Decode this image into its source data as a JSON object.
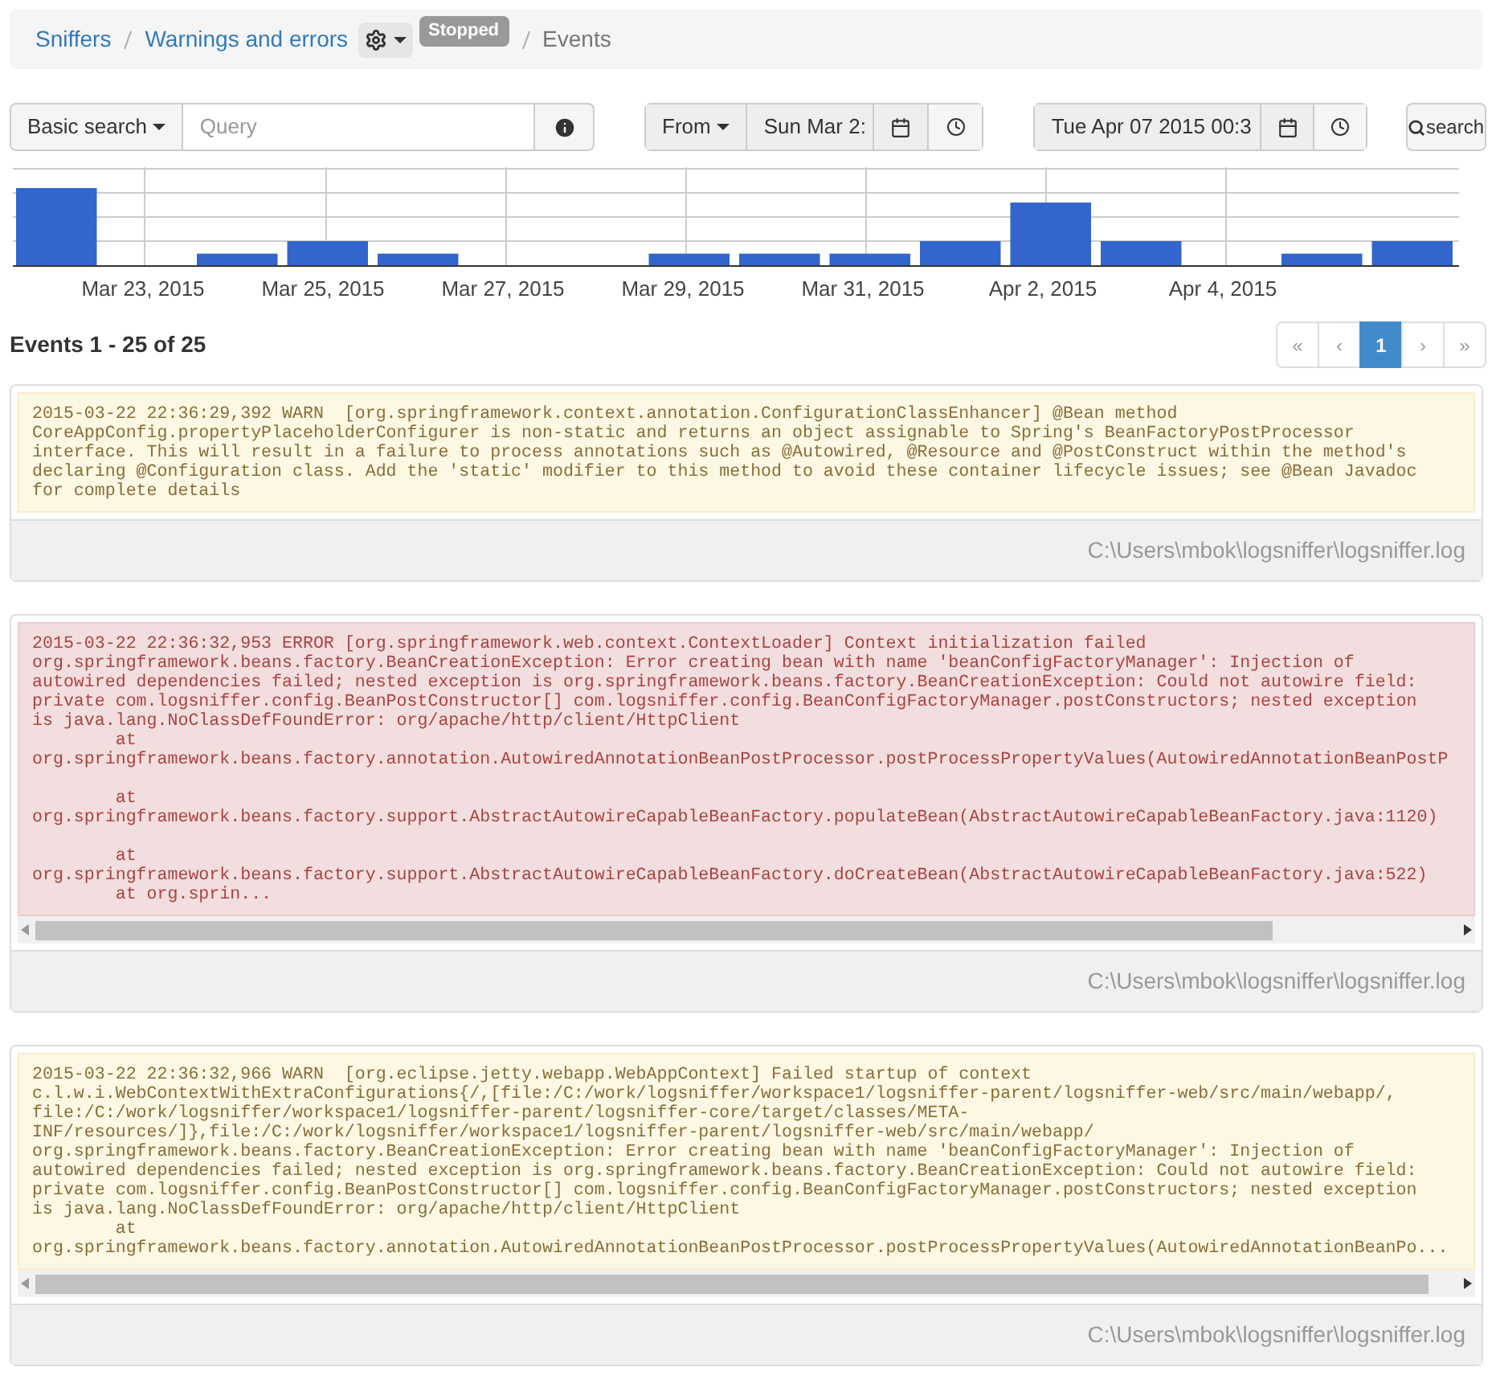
{
  "breadcrumb": {
    "items": [
      {
        "label": "Sniffers",
        "kind": "link"
      },
      {
        "label": "Warnings and errors",
        "kind": "link"
      },
      {
        "label": "Events",
        "kind": "current"
      }
    ],
    "status_badge": "Stopped"
  },
  "search": {
    "mode": "Basic search",
    "placeholder": "Query",
    "from_label": "From",
    "from_value": "Sun Mar 2:",
    "to_value": "Tue Apr 07 2015 00:3",
    "search_button": "search"
  },
  "histogram": {
    "date_labels": [
      "Mar 23, 2015",
      "Mar 25, 2015",
      "Mar 27, 2015",
      "Mar 29, 2015",
      "Mar 31, 2015",
      "Apr 2, 2015",
      "Apr 4, 2015"
    ]
  },
  "events_heading": "Events 1 - 25 of 25",
  "pagination": [
    {
      "label": "«",
      "selected": false
    },
    {
      "label": "‹",
      "selected": false
    },
    {
      "label": "1",
      "selected": true
    },
    {
      "label": "›",
      "selected": false
    },
    {
      "label": "»",
      "selected": false
    }
  ],
  "events": [
    {
      "kind": "warn",
      "scrollable": false,
      "message": "2015-03-22 22:36:29,392 WARN  [org.springframework.context.annotation.ConfigurationClassEnhancer] @Bean method\nCoreAppConfig.propertyPlaceholderConfigurer is non-static and returns an object assignable to Spring's BeanFactoryPostProcessor\ninterface. This will result in a failure to process annotations such as @Autowired, @Resource and @PostConstruct within the method's\ndeclaring @Configuration class. Add the 'static' modifier to this method to avoid these container lifecycle issues; see @Bean Javadoc\nfor complete details",
      "source": "C:\\Users\\mbok\\logsniffer\\logsniffer.log"
    },
    {
      "kind": "error",
      "scrollable": true,
      "message": "2015-03-22 22:36:32,953 ERROR [org.springframework.web.context.ContextLoader] Context initialization failed\norg.springframework.beans.factory.BeanCreationException: Error creating bean with name 'beanConfigFactoryManager': Injection of\nautowired dependencies failed; nested exception is org.springframework.beans.factory.BeanCreationException: Could not autowire field:\nprivate com.logsniffer.config.BeanPostConstructor[] com.logsniffer.config.BeanConfigFactoryManager.postConstructors; nested exception\nis java.lang.NoClassDefFoundError: org/apache/http/client/HttpClient\n        at\norg.springframework.beans.factory.annotation.AutowiredAnnotationBeanPostProcessor.postProcessPropertyValues(AutowiredAnnotationBeanPostP\n\n        at\norg.springframework.beans.factory.support.AbstractAutowireCapableBeanFactory.populateBean(AbstractAutowireCapableBeanFactory.java:1120)\n\n        at\norg.springframework.beans.factory.support.AbstractAutowireCapableBeanFactory.doCreateBean(AbstractAutowireCapableBeanFactory.java:522)\n        at org.sprin...",
      "source": "C:\\Users\\mbok\\logsniffer\\logsniffer.log"
    },
    {
      "kind": "warn",
      "scrollable": true,
      "message": "2015-03-22 22:36:32,966 WARN  [org.eclipse.jetty.webapp.WebAppContext] Failed startup of context\nc.l.w.i.WebContextWithExtraConfigurations{/,[file:/C:/work/logsniffer/workspace1/logsniffer-parent/logsniffer-web/src/main/webapp/,\nfile:/C:/work/logsniffer/workspace1/logsniffer-parent/logsniffer-core/target/classes/META-\nINF/resources/]},file:/C:/work/logsniffer/workspace1/logsniffer-parent/logsniffer-web/src/main/webapp/\norg.springframework.beans.factory.BeanCreationException: Error creating bean with name 'beanConfigFactoryManager': Injection of\nautowired dependencies failed; nested exception is org.springframework.beans.factory.BeanCreationException: Could not autowire field:\nprivate com.logsniffer.config.BeanPostConstructor[] com.logsniffer.config.BeanConfigFactoryManager.postConstructors; nested exception\nis java.lang.NoClassDefFoundError: org/apache/http/client/HttpClient\n        at\norg.springframework.beans.factory.annotation.AutowiredAnnotationBeanPostProcessor.postProcessPropertyValues(AutowiredAnnotationBeanPo...",
      "source": "C:\\Users\\mbok\\logsniffer\\logsniffer.log"
    }
  ]
}
